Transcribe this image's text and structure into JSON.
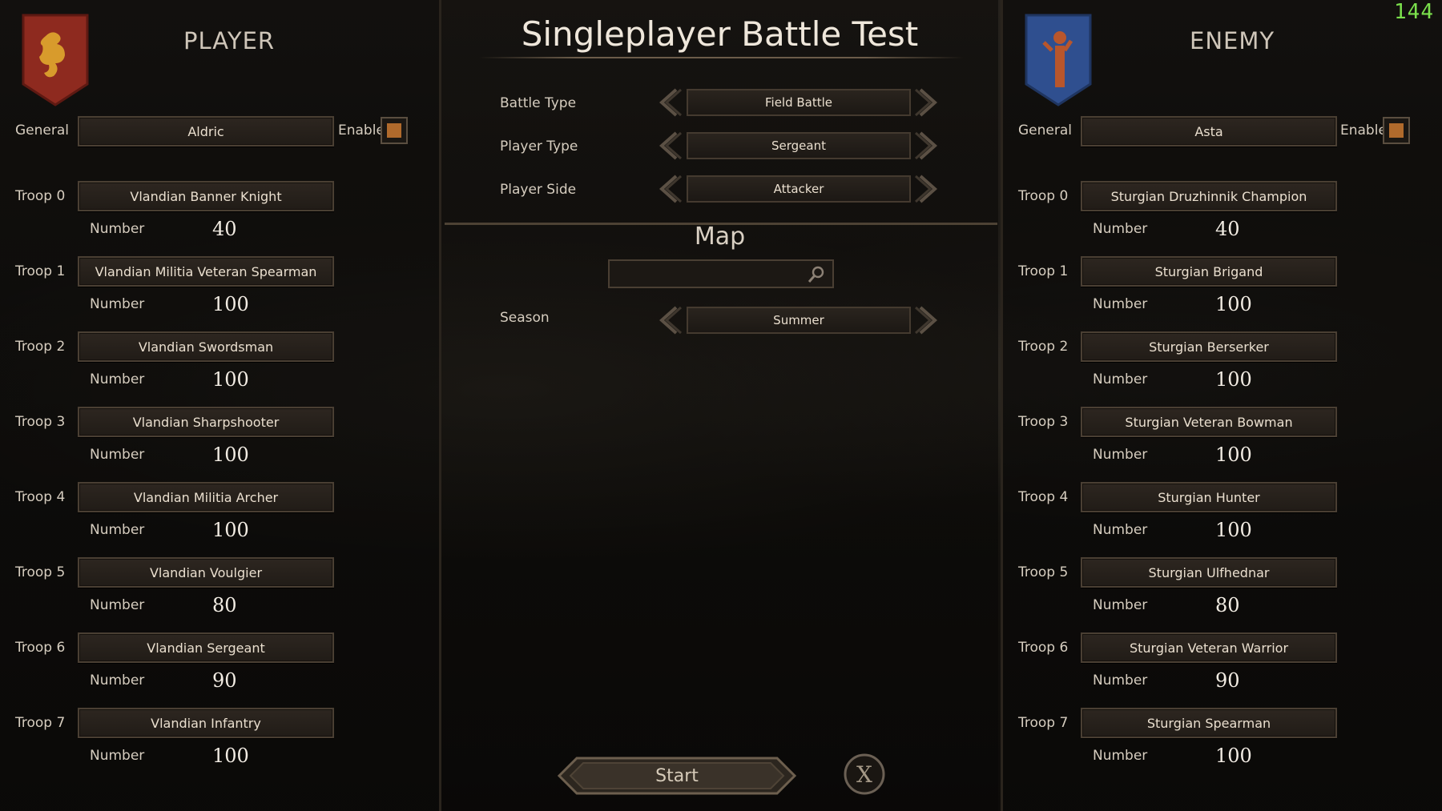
{
  "fps_counter": "144",
  "title": "Singleplayer Battle Test",
  "player": {
    "heading": "PLAYER",
    "general_label": "General",
    "general_value": "Aldric",
    "enable_label": "Enable",
    "number_label": "Number",
    "troops": [
      {
        "label": "Troop 0",
        "name": "Vlandian Banner Knight",
        "number": "40"
      },
      {
        "label": "Troop 1",
        "name": "Vlandian Militia Veteran Spearman",
        "number": "100"
      },
      {
        "label": "Troop 2",
        "name": "Vlandian Swordsman",
        "number": "100"
      },
      {
        "label": "Troop 3",
        "name": "Vlandian Sharpshooter",
        "number": "100"
      },
      {
        "label": "Troop 4",
        "name": "Vlandian Militia Archer",
        "number": "100"
      },
      {
        "label": "Troop 5",
        "name": "Vlandian Voulgier",
        "number": "80"
      },
      {
        "label": "Troop 6",
        "name": "Vlandian Sergeant",
        "number": "90"
      },
      {
        "label": "Troop 7",
        "name": "Vlandian Infantry",
        "number": "100"
      }
    ]
  },
  "enemy": {
    "heading": "ENEMY",
    "general_label": "General",
    "general_value": "Asta",
    "enable_label": "Enable",
    "number_label": "Number",
    "troops": [
      {
        "label": "Troop 0",
        "name": "Sturgian Druzhinnik Champion",
        "number": "40"
      },
      {
        "label": "Troop 1",
        "name": "Sturgian Brigand",
        "number": "100"
      },
      {
        "label": "Troop 2",
        "name": "Sturgian Berserker",
        "number": "100"
      },
      {
        "label": "Troop 3",
        "name": "Sturgian Veteran Bowman",
        "number": "100"
      },
      {
        "label": "Troop 4",
        "name": "Sturgian Hunter",
        "number": "100"
      },
      {
        "label": "Troop 5",
        "name": "Sturgian Ulfhednar",
        "number": "80"
      },
      {
        "label": "Troop 6",
        "name": "Sturgian Veteran Warrior",
        "number": "90"
      },
      {
        "label": "Troop 7",
        "name": "Sturgian Spearman",
        "number": "100"
      }
    ]
  },
  "settings": {
    "battle_type": {
      "label": "Battle Type",
      "value": "Field Battle"
    },
    "player_type": {
      "label": "Player Type",
      "value": "Sergeant"
    },
    "player_side": {
      "label": "Player Side",
      "value": "Attacker"
    },
    "map_heading": "Map",
    "map_search_value": "",
    "season": {
      "label": "Season",
      "value": "Summer"
    }
  },
  "actions": {
    "start_label": "Start",
    "close_glyph": "X"
  },
  "colors": {
    "player_banner": "#8e2a1f",
    "enemy_banner": "#2f4f8f",
    "checkbox_fill": "#b06a2c",
    "fps_color": "#7be04c"
  }
}
